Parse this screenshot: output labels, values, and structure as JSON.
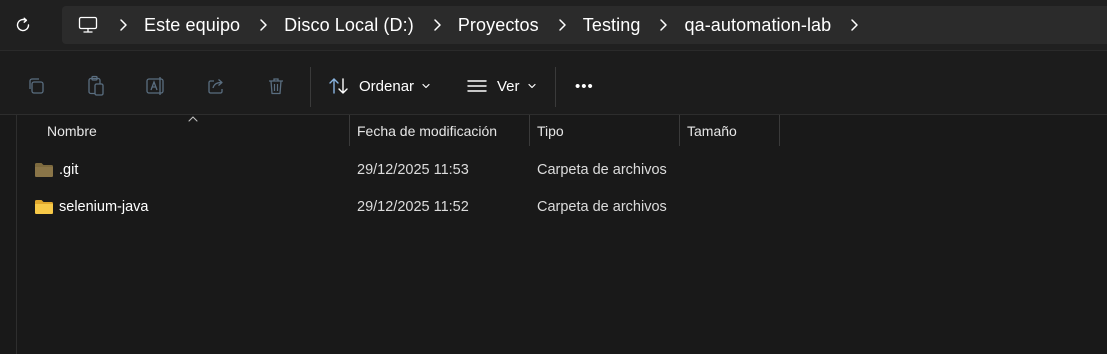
{
  "breadcrumb": {
    "items": [
      "Este equipo",
      "Disco Local (D:)",
      "Proyectos",
      "Testing",
      "qa-automation-lab"
    ]
  },
  "icons": {
    "refresh": "refresh-icon",
    "computer": "computer-icon",
    "chevron": "chevron-right-icon"
  },
  "toolbar": {
    "sort_label": "Ordenar",
    "view_label": "Ver",
    "more_label": "•••"
  },
  "columns": {
    "name": "Nombre",
    "modified": "Fecha de modificación",
    "type": "Tipo",
    "size": "Tamaño"
  },
  "files": [
    {
      "name": ".git",
      "modified": "29/12/2025 11:53",
      "type": "Carpeta de archivos",
      "size": "",
      "hidden": true
    },
    {
      "name": "selenium-java",
      "modified": "29/12/2025 11:52",
      "type": "Carpeta de archivos",
      "size": "",
      "hidden": false
    }
  ],
  "colors": {
    "folder": "#f6c544",
    "folder_dim": "#8a7340",
    "background": "#191919",
    "address_bg": "#2b2b2b"
  }
}
